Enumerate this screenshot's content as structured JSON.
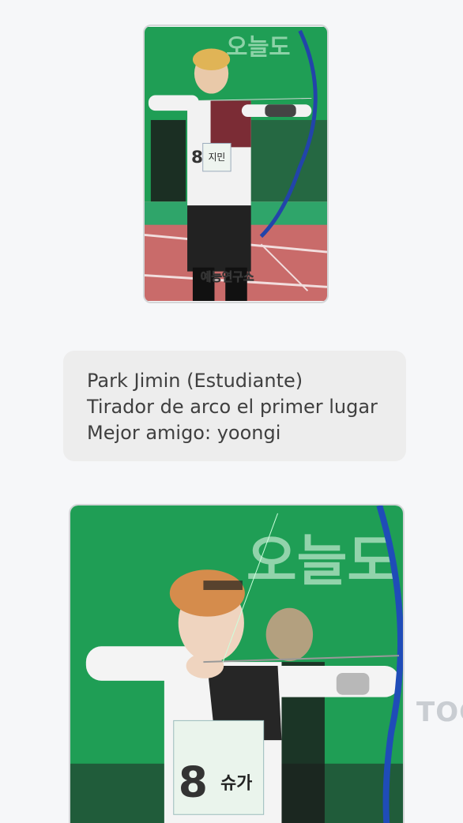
{
  "photo1": {
    "banner_text": "오늘도",
    "name_tag": "지민",
    "bib_number": "8",
    "watermark": "예능연구소"
  },
  "bio": {
    "line1": "Park Jimin (Estudiante)",
    "line2": "Tirador de arco el primer lugar",
    "line3": "Mejor amigo: yoongi"
  },
  "photo2": {
    "banner_text": "오늘도",
    "name_tag": "슈가",
    "bib_number": "8"
  },
  "side_watermark": "TOG",
  "colors": {
    "background": "#f6f7f9",
    "bubble": "#ededed",
    "text": "#3f3f3f",
    "field_green": "#1f9e55"
  }
}
